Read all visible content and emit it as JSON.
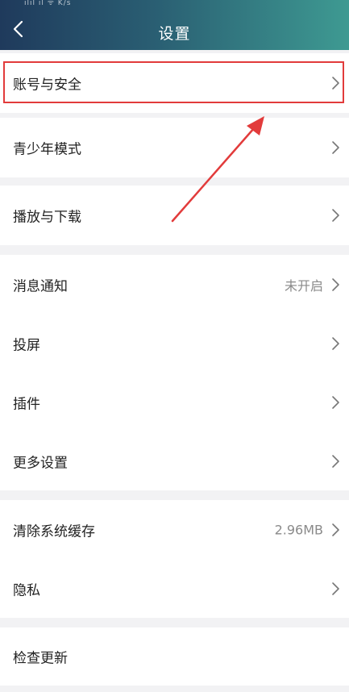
{
  "header": {
    "title": "设置",
    "status_text": "ılıl ıl ᯤ K/s"
  },
  "rows": [
    {
      "label": "账号与安全",
      "value": ""
    },
    {
      "label": "青少年模式",
      "value": ""
    },
    {
      "label": "播放与下载",
      "value": ""
    },
    {
      "label": "消息通知",
      "value": "未开启"
    },
    {
      "label": "投屏",
      "value": ""
    },
    {
      "label": "插件",
      "value": ""
    },
    {
      "label": "更多设置",
      "value": ""
    },
    {
      "label": "清除系统缓存",
      "value": "2.96MB"
    },
    {
      "label": "隐私",
      "value": ""
    },
    {
      "label": "检查更新",
      "value": ""
    }
  ],
  "colors": {
    "highlight": "#e23b3b",
    "arrow": "#e23b3b"
  },
  "icons": {
    "back": "chevron-left-icon",
    "row": "chevron-right-icon"
  }
}
